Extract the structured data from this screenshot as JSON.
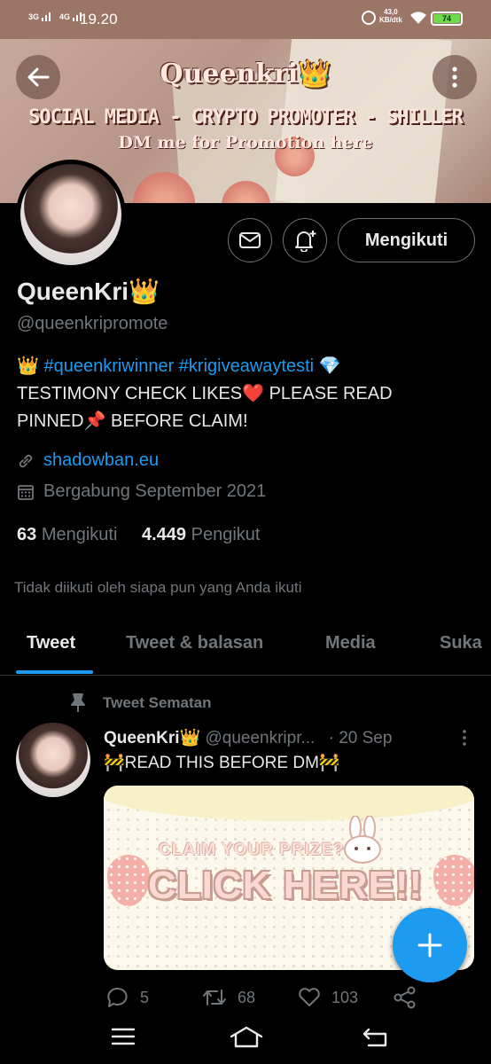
{
  "status_bar": {
    "network1": "3G",
    "network2": "4G",
    "time": "19.20",
    "speed_value": "43,0",
    "speed_unit": "KB/dtk",
    "battery": "74"
  },
  "banner": {
    "title": "Queenkri👑",
    "subtitle": "SOCIAL MEDIA - CRYPTO PROMOTER - SHILLER",
    "dm_text": "DM me for Promotion here"
  },
  "profile": {
    "follow_button": "Mengikuti",
    "display_name": "QueenKri👑",
    "handle": "@queenkripromote",
    "bio_prefix": "👑 ",
    "bio_hashtags": "#queenkriwinner #krigiveawaytesti",
    "bio_suffix": " 💎",
    "bio_line2": "TESTIMONY CHECK LIKES❤️ PLEASE READ",
    "bio_line3": "PINNED📌 BEFORE CLAIM!",
    "website": "shadowban.eu",
    "joined": "Bergabung September 2021",
    "following_count": "63",
    "following_label": "Mengikuti",
    "followers_count": "4.449",
    "followers_label": "Pengikut",
    "not_followed_text": "Tidak diikuti oleh siapa pun yang Anda ikuti"
  },
  "tabs": [
    {
      "label": "Tweet"
    },
    {
      "label": "Tweet & balasan"
    },
    {
      "label": "Media"
    },
    {
      "label": "Suka"
    }
  ],
  "tweet": {
    "pinned_label": "Tweet Sematan",
    "author_name": "QueenKri👑",
    "author_handle": "@queenkripr...",
    "date": "· 20 Sep",
    "text": "🚧READ THIS BEFORE DM🚧",
    "media_claim": "CLAIM YOUR PRIZE?",
    "media_click": "CLICK HERE!!",
    "replies": "5",
    "retweets": "68",
    "likes": "103"
  },
  "colors": {
    "accent": "#1d9bf0",
    "status_bar": "#9b7565",
    "battery": "#6ddb4c"
  }
}
